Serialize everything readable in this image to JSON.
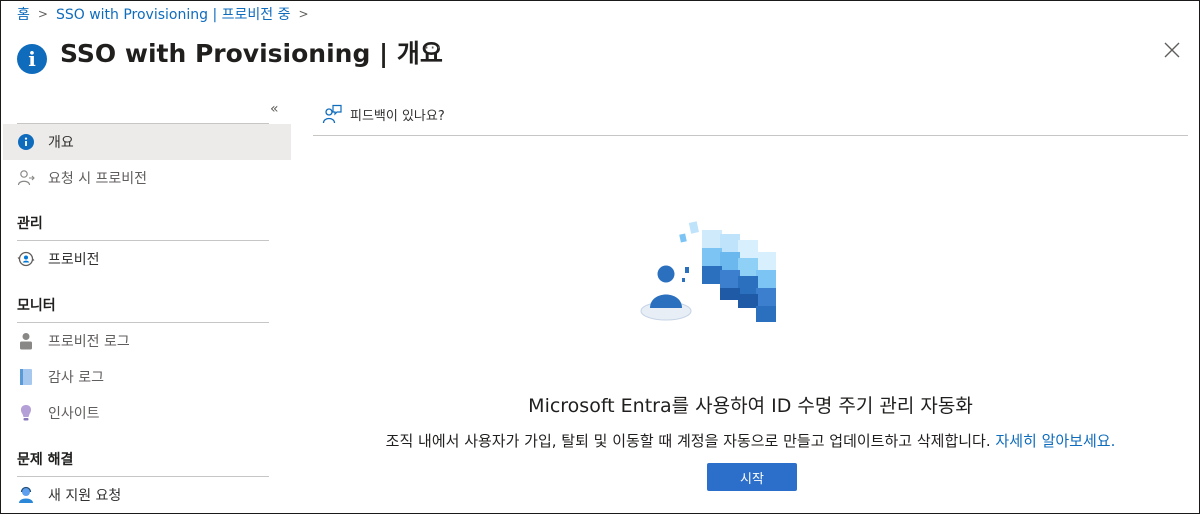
{
  "breadcrumb": {
    "home": "홈",
    "current": "SSO with Provisioning | 프로비전 중"
  },
  "header": {
    "title": "SSO with Provisioning | 개요",
    "more": "···"
  },
  "sidebar": {
    "top_items": [
      {
        "label": "개요",
        "icon": "info-icon"
      },
      {
        "label": "요청 시 프로비전",
        "icon": "user-provision-icon"
      }
    ],
    "groups": [
      {
        "label": "관리",
        "items": [
          {
            "label": "프로비전",
            "icon": "provisioning-icon"
          }
        ]
      },
      {
        "label": "모니터",
        "items": [
          {
            "label": "프로비전 로그",
            "icon": "provisioning-log-icon"
          },
          {
            "label": "감사 로그",
            "icon": "audit-log-icon"
          },
          {
            "label": "인사이트",
            "icon": "insights-icon"
          }
        ]
      },
      {
        "label": "문제 해결",
        "items": [
          {
            "label": "새 지원 요청",
            "icon": "support-request-icon"
          }
        ]
      }
    ]
  },
  "main": {
    "feedback": "피드백이 있나요?",
    "headline": "Microsoft Entra를 사용하여 ID 수명 주기 관리 자동화",
    "description": "조직 내에서 사용자가 가입, 탈퇴 및 이동할 때 계정을 자동으로 만들고 업데이트하고 삭제합니다.",
    "learn_more": "자세히 알아보세요.",
    "start_button": "시작"
  },
  "colors": {
    "accent": "#0f6cbd",
    "button": "#2c6fca",
    "selected_bg": "#edebe9"
  }
}
